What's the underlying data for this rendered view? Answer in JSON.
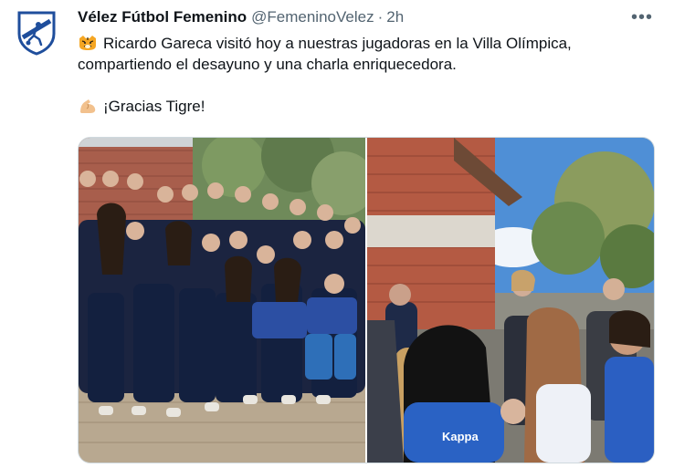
{
  "tweet": {
    "author_name": "Vélez Fútbol Femenino",
    "author_handle": "@FemeninoVelez",
    "separator": "·",
    "time": "2h",
    "more_label": "•••",
    "text_line1": "Ricardo Gareca visitó hoy a nuestras jugadoras en la Villa Olímpica,",
    "text_line2": "compartiendo el desayuno y una charla enriquecedora.",
    "text_line3": "¡Gracias Tigre!",
    "emoji1": "tiger-face-icon",
    "emoji2": "flexed-biceps-icon",
    "accent_color": "#1d9bf0",
    "handle_color": "#536471"
  },
  "media": {
    "photo_count": 2,
    "photo2_shirt_text": "Kappa"
  }
}
